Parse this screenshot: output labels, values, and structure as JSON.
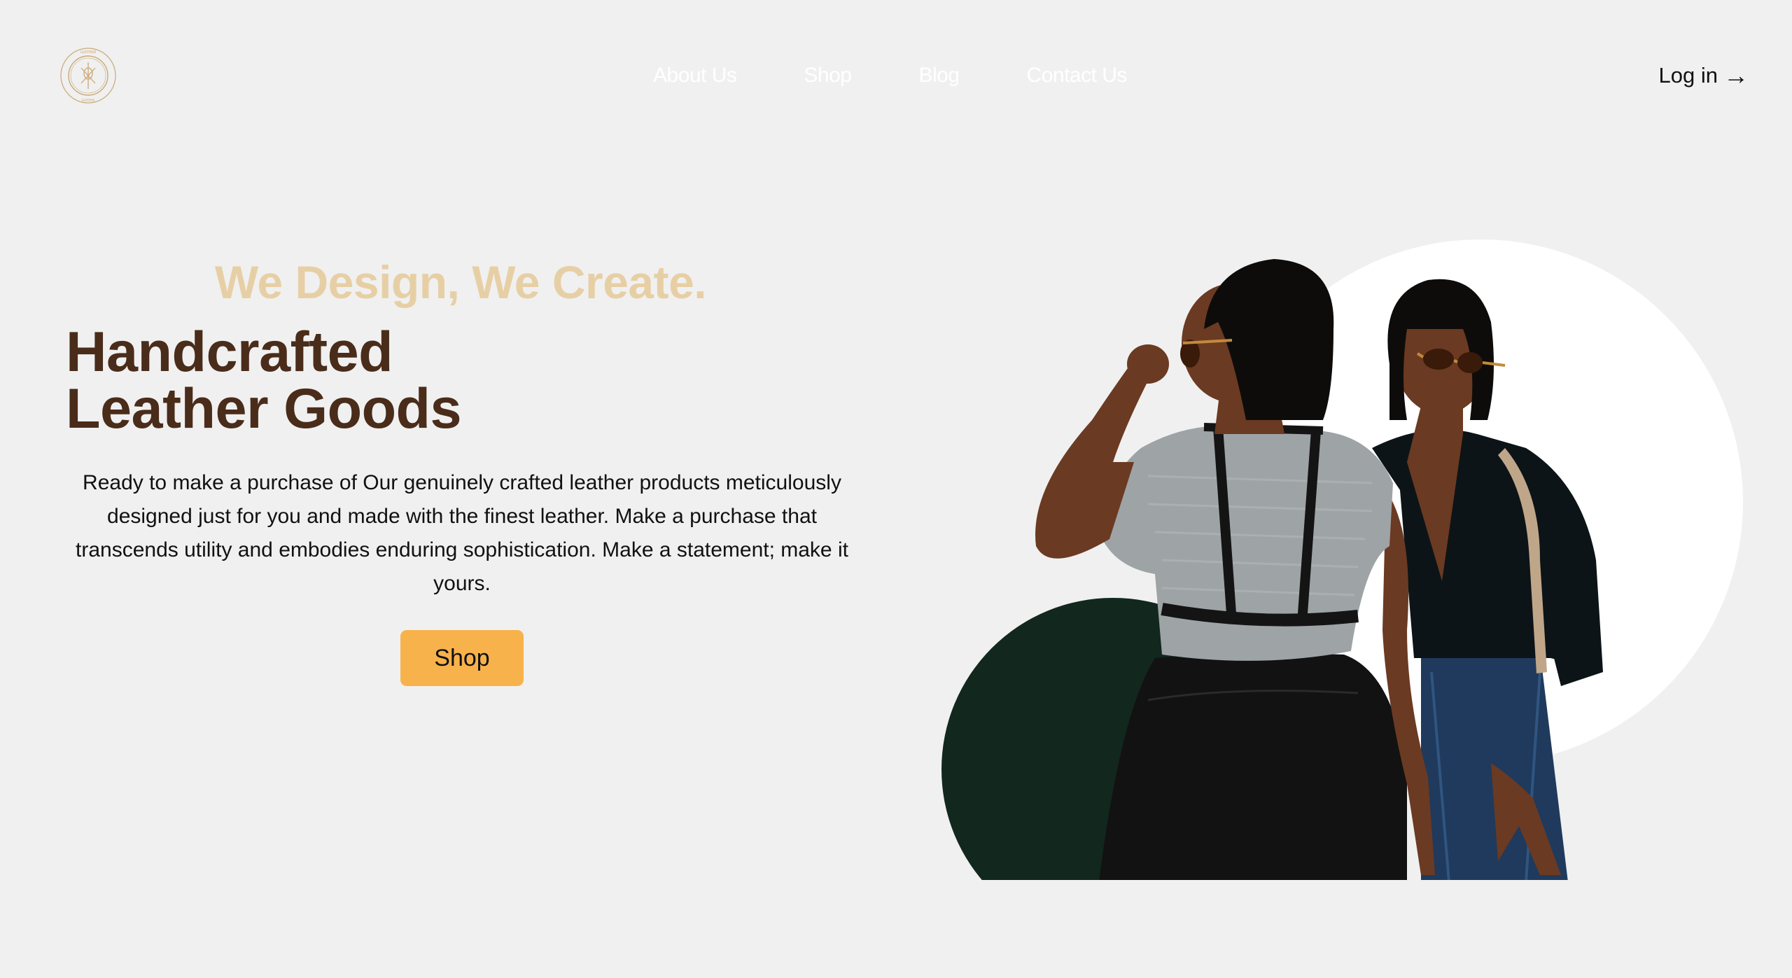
{
  "header": {
    "logo_alt": "leather-logo",
    "nav": [
      {
        "label": "About Us"
      },
      {
        "label": "Shop"
      },
      {
        "label": "Blog"
      },
      {
        "label": "Contact Us"
      }
    ],
    "login_label": "Log in",
    "login_arrow": "→"
  },
  "hero": {
    "tagline": "We Design, We Create.",
    "headline_line1": "Handcrafted",
    "headline_line2": "Leather Goods",
    "description": "Ready to make a purchase of Our genuinely crafted leather products meticulously designed just for you and made with the finest leather. Make a purchase that transcends utility and embodies enduring sophistication. Make a statement; make it yours.",
    "cta_label": "Shop"
  },
  "colors": {
    "background": "#f0f0f0",
    "tagline": "#e7cfa5",
    "headline": "#4a2c1a",
    "cta": "#f8b24b",
    "accent_green": "#12271d",
    "logo": "#c9a876"
  }
}
